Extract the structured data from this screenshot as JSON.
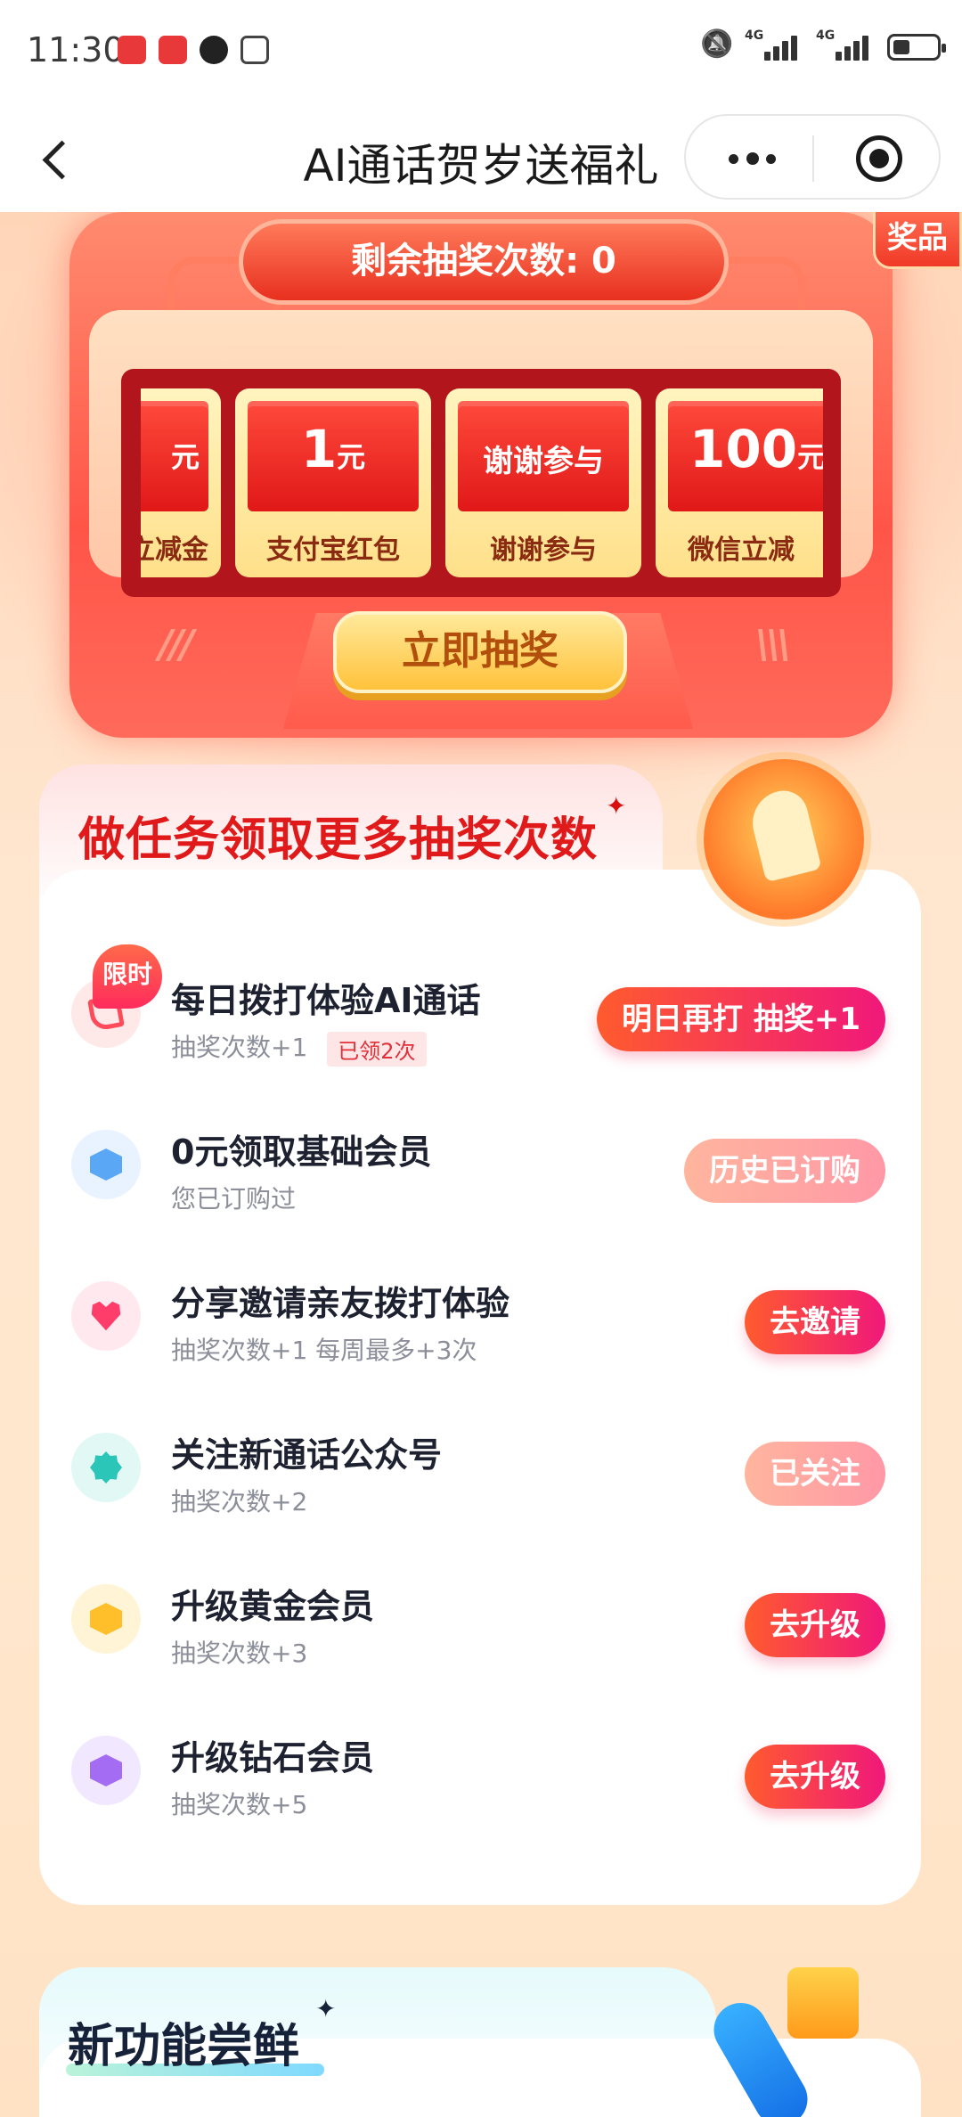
{
  "status_bar": {
    "time": "11:30",
    "net1": "4G",
    "net2": "4G"
  },
  "header": {
    "title": "AI通话贺岁送福礼"
  },
  "lottery": {
    "prize_tag": "奖品",
    "remaining_label": "剩余抽奖次数: 0",
    "prizes": [
      {
        "value": "元",
        "label": "立减金"
      },
      {
        "value": "1",
        "unit": "元",
        "label": "支付宝红包"
      },
      {
        "value": "谢谢参与",
        "label": "谢谢参与"
      },
      {
        "value": "100",
        "unit": "元",
        "label": "微信立减"
      }
    ],
    "draw_button": "立即抽奖"
  },
  "tasks": {
    "title": "做任务领取更多抽奖次数",
    "limited_badge": "限时",
    "items": [
      {
        "title": "每日拨打体验AI通话",
        "sub": "抽奖次数+1",
        "badge": "已领2次",
        "button": "明日再打 抽奖+1",
        "icon": "phone-icon"
      },
      {
        "title": "0元领取基础会员",
        "sub": "您已订购过",
        "button": "历史已订购",
        "icon": "crown-icon"
      },
      {
        "title": "分享邀请亲友拨打体验",
        "sub": "抽奖次数+1 每周最多+3次",
        "button": "去邀请",
        "icon": "heart-icon"
      },
      {
        "title": "关注新通话公众号",
        "sub": "抽奖次数+2",
        "button": "已关注",
        "icon": "verified-icon"
      },
      {
        "title": "升级黄金会员",
        "sub": "抽奖次数+3",
        "button": "去升级",
        "icon": "gold-crown-icon"
      },
      {
        "title": "升级钻石会员",
        "sub": "抽奖次数+5",
        "button": "去升级",
        "icon": "diamond-crown-icon"
      }
    ]
  },
  "new_features": {
    "title": "新功能尝鲜"
  },
  "colors": {
    "accent_red": "#e01a1a",
    "button_gradient_start": "#ff5b2e",
    "button_gradient_end": "#f0187a"
  }
}
